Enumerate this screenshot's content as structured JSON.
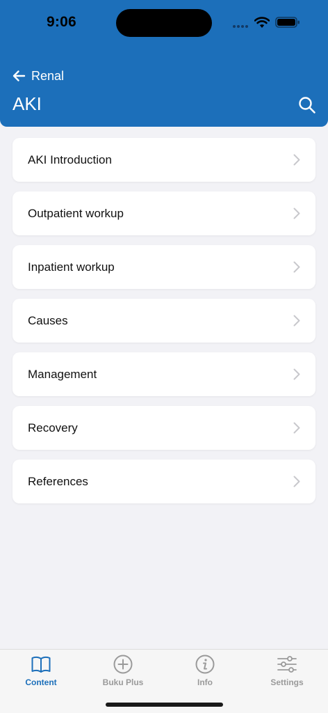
{
  "status": {
    "time": "9:06"
  },
  "nav": {
    "back_label": "Renal",
    "title": "AKI"
  },
  "items": [
    {
      "label": "AKI Introduction"
    },
    {
      "label": "Outpatient workup"
    },
    {
      "label": "Inpatient workup"
    },
    {
      "label": "Causes"
    },
    {
      "label": "Management"
    },
    {
      "label": "Recovery"
    },
    {
      "label": "References"
    }
  ],
  "tabs": [
    {
      "label": "Content",
      "icon": "book-icon",
      "active": true
    },
    {
      "label": "Buku Plus",
      "icon": "plus-circle-icon",
      "active": false
    },
    {
      "label": "Info",
      "icon": "info-icon",
      "active": false
    },
    {
      "label": "Settings",
      "icon": "sliders-icon",
      "active": false
    }
  ],
  "colors": {
    "header": "#1c6fba",
    "background": "#f2f2f6",
    "tab_active": "#1c6fba",
    "tab_inactive": "#9a9a9a"
  }
}
